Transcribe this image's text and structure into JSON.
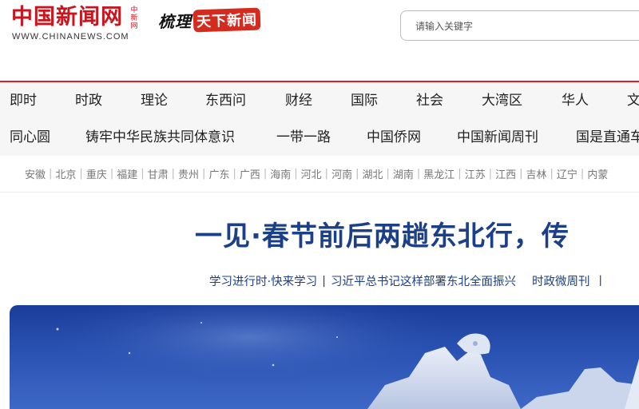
{
  "header": {
    "logo_cn": "中国新闻网",
    "logo_vertical": "中新网",
    "logo_en": "WWW.CHINANEWS.COM",
    "slogan_main": "梳理",
    "slogan_badge": "天下新闻",
    "search_placeholder": "请输入关键字",
    "accent_color": "#d1202a"
  },
  "nav_primary": [
    {
      "label": "即时"
    },
    {
      "label": "时政"
    },
    {
      "label": "理论"
    },
    {
      "label": "东西问"
    },
    {
      "label": "财经"
    },
    {
      "label": "国际"
    },
    {
      "label": "社会"
    },
    {
      "label": "大湾区"
    },
    {
      "label": "华人"
    },
    {
      "label": "文"
    }
  ],
  "nav_secondary": [
    {
      "label": "同心圆"
    },
    {
      "label": "铸牢中华民族共同体意识"
    },
    {
      "label": "一带一路"
    },
    {
      "label": "中国侨网"
    },
    {
      "label": "中国新闻周刊"
    },
    {
      "label": "国是直通车"
    }
  ],
  "regions": [
    "安徽",
    "北京",
    "重庆",
    "福建",
    "甘肃",
    "贵州",
    "广东",
    "广西",
    "海南",
    "河北",
    "河南",
    "湖北",
    "湖南",
    "黑龙江",
    "江苏",
    "江西",
    "吉林",
    "辽宁",
    "内蒙"
  ],
  "headline": {
    "title": "一见·春节前后两趟东北行，传"
  },
  "sublinks": {
    "link_1": "学习进行时·快来学习",
    "link_2": "习近平总书记这样部署东北全面振兴",
    "link_3": "时政微周刊",
    "separator": "|",
    "trailing": "丨"
  },
  "hero": {
    "icon": "ice-sculpture-photo",
    "sky_color": "#1b3d9a"
  }
}
